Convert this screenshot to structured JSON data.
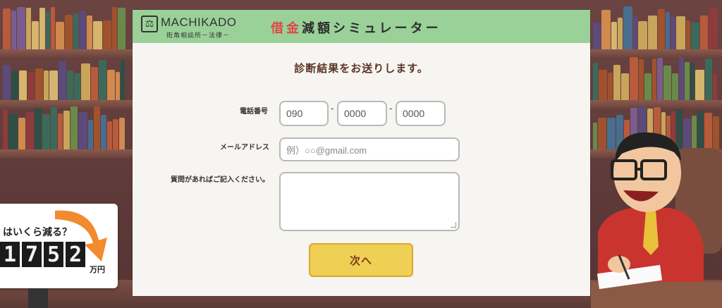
{
  "header": {
    "logo_name": "MACHIKADO",
    "logo_sub": "街角相談所－法律－",
    "title_accent": "借金",
    "title_rest": "減額シミュレーター"
  },
  "form": {
    "heading": "診断結果をお送りします。",
    "phone": {
      "label": "電話番号",
      "part1": "090",
      "part2": "0000",
      "part3": "0000",
      "separator": "-"
    },
    "email": {
      "label": "メールアドレス",
      "placeholder": "例）○○@gmail.com"
    },
    "question": {
      "label": "質問があればご記入ください。",
      "value": ""
    },
    "next_button": "次へ"
  },
  "counter": {
    "question": "はいくら減る？",
    "digits": [
      "1",
      "7",
      "5",
      "2"
    ],
    "unit": "万円",
    "arrow_color": "#f28a2e"
  },
  "colors": {
    "header_bg": "#9ad198",
    "accent_red": "#e04646",
    "button_bg": "#f0cf55",
    "heading_brown": "#5a3426"
  }
}
